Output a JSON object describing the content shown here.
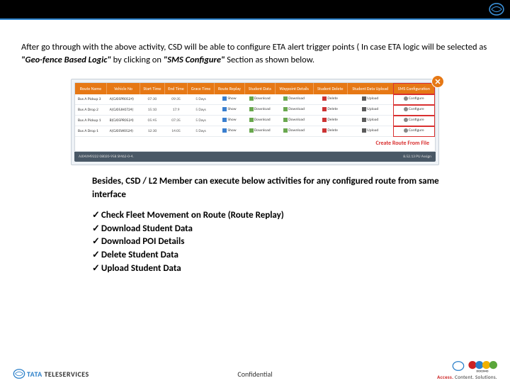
{
  "intro": {
    "pre": "After go through with the above activity, CSD will be able to configure ETA alert trigger points ( In case ETA logic will be selected as ",
    "emph1": "\"Geo-fence Based Logic\"",
    "mid": " by clicking on ",
    "emph2": "\"SMS Configure\"",
    "post": " Section as shown below."
  },
  "table": {
    "headers": [
      "Route Name",
      "Vehicle No",
      "Start Time",
      "End Time",
      "Grace Time",
      "Route Replay",
      "Student Data",
      "Waypoint Details",
      "Student Delete",
      "Student Data Upload",
      "SMS Configuration"
    ],
    "rows": [
      {
        "route": "Bus A Pickup 3",
        "vehicle": "A(GJ05PR0524)",
        "start": "07:30",
        "end": "09:35",
        "grace": "5 Days",
        "show": "Show",
        "download": "Download",
        "way": "Download",
        "delete": "Delete",
        "upload": "Upload",
        "sms": "Configure"
      },
      {
        "route": "Bus A Drop 2",
        "vehicle": "A(GJ05JH0724)",
        "start": "15:10",
        "end": "17:9",
        "grace": "5 Days",
        "show": "Show",
        "download": "Download",
        "way": "Download",
        "delete": "Delete",
        "upload": "Upload",
        "sms": "Configure"
      },
      {
        "route": "Bus A Pickup 1",
        "vehicle": "B(GJ05PR0524)",
        "start": "05:45",
        "end": "07:35",
        "grace": "5 Days",
        "show": "Show",
        "download": "Download",
        "way": "Download",
        "delete": "Delete",
        "upload": "Upload",
        "sms": "Configure"
      },
      {
        "route": "Bus A Drop 1",
        "vehicle": "A(GJ05W0524)",
        "start": "12:30",
        "end": "14:05",
        "grace": "5 Days",
        "show": "Show",
        "download": "Download",
        "way": "Download",
        "delete": "Delete",
        "upload": "Upload",
        "sms": "Configure"
      }
    ],
    "create_link": "Create Route From File",
    "strip": {
      "left": "AJ04JM9222   08020-958   SM62-0-4.",
      "right": "8.52.13 PU     Assign"
    }
  },
  "secondary": {
    "head": "Besides, CSD / L2 Member can execute below activities for any configured route from same interface",
    "items": [
      "Check Fleet Movement on Route (Route Replay)",
      "Download Student Data",
      "Download POI Details",
      "Delete Student Data",
      "Upload Student Data"
    ]
  },
  "footer": {
    "confidential": "Confidential",
    "brand_tata": "TATA ",
    "brand_tele": "TELESERVICES",
    "tagline_a": "Access.",
    "tagline_b": " Content. Solutions."
  }
}
